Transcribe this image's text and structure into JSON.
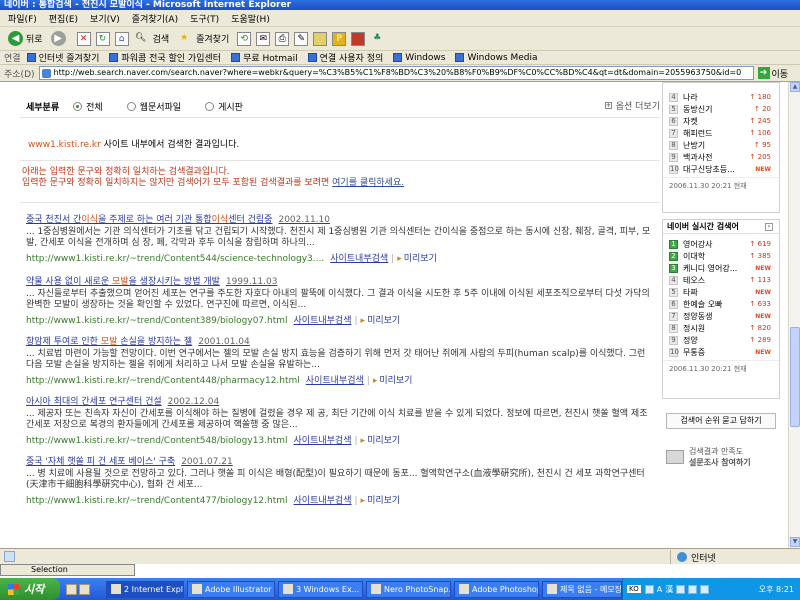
{
  "window": {
    "title": "네이버 : 통합검색 - 천진시 모발이식 - Microsoft Internet Explorer"
  },
  "menu": [
    "파일(F)",
    "편집(E)",
    "보기(V)",
    "즐겨찾기(A)",
    "도구(T)",
    "도움말(H)"
  ],
  "toolbar": {
    "back": "뒤로",
    "search": "검색",
    "favorites": "즐겨찾기"
  },
  "links": {
    "label": "연결",
    "items": [
      "인터넷 즐겨찾기",
      "파워콤 전국 할인 가입센터",
      "무료 Hotmail",
      "연결 사용자 정의",
      "Windows",
      "Windows Media"
    ]
  },
  "address": {
    "label": "주소(D)",
    "url": "http://web.search.naver.com/search.naver?where=webkr&query=%C3%B5%C1%F8%BD%C3%20%B8%F0%B9%DF%C0%CC%BD%C4&qt=dt&domain=2055963750&id=0",
    "go": "이동"
  },
  "filter": {
    "label": "세부분류",
    "options": [
      "전체",
      "웹문서파일",
      "게시판"
    ],
    "selected": "전체",
    "more": "옵션 더보기"
  },
  "intro": {
    "site": "www1.kisti.re.kr",
    "text": " 사이트 내부에서 검색한 결과입니다."
  },
  "notice": {
    "line1": "아래는 입력한 문구와 정확히 일치하는 검색결과입니다.",
    "line2": "입력한 문구와 정확히 일치하지는 않지만 검색어가 모두 포함된 검색결과를 보려면 ",
    "link": "여기를 클릭하세요."
  },
  "results": [
    {
      "title_pre": "중국 천진서 간",
      "title_hl": "이식",
      "title_mid": "을 주제로 하는 여러 기관 통합",
      "title_hl2": "이식",
      "title_post": "센터 건립중",
      "date": "2002.11.10",
      "desc": "... 1중심병원에서는 기관 의식센터가 기초를 닦고 건립되기 시작했다. 천진시 제 1중심병원 기관 의식센터는 간이식을 중점으로 하는 동시에 신장, 췌장, 골격, 피부, 모발, 간세포 이식을 전개하며 심 장, 폐, 각막과 후두 이식을 창립하며 하나의...",
      "url": "http://www1.kisti.re.kr/~trend/Content544/science-technology3....",
      "site_link": "사이트내부검색",
      "preview": "미리보기"
    },
    {
      "title_pre": "약물 사용 없이 새로운 ",
      "title_hl": "모발",
      "title_mid": "을 생장시키는 방법 개발",
      "title_hl2": "",
      "title_post": "",
      "date": "1999.11.03",
      "desc": "... 자신들로부터 추출했으며 얻어진 세포는 연구를 주도한 자호다 아내의 팔뚝에 이식했다. 그 결과 이식을 시도한 후 5주 이내에 이식된 세포조직으로부터 다섯 가닥의 완벽한 모발이 생장하는 것을 확인할 수 있었다. 연구진에 따르면, 이식된...",
      "url": "http://www1.kisti.re.kr/~trend/Content389/biology07.html",
      "site_link": "사이트내부검색",
      "preview": "미리보기"
    },
    {
      "title_pre": "항암제 투여로 인한 ",
      "title_hl": "모발",
      "title_mid": " 손실을 방지하는 젤",
      "title_hl2": "",
      "title_post": "",
      "date": "2001.01.04",
      "desc": "... 치료법 마련이 가능할 전망이다. 이번 연구에서는 젤의 모발 손실 방지 효능을 검증하기 위해 먼저 갓 태어난 쥐에게 사람의 두피(human scalp)를 이식했다. 그런 다음 모발 손실을 방지하는 젤을 쥐에게 처리하고 나서 모발 손실을 유발하는...",
      "url": "http://www1.kisti.re.kr/~trend/Content448/pharmacy12.html",
      "site_link": "사이트내부검색",
      "preview": "미리보기"
    },
    {
      "title_pre": "아시아 최대의 간세포 연구센터 건설",
      "title_hl": "",
      "title_mid": "",
      "title_hl2": "",
      "title_post": "",
      "date": "2002.12.04",
      "desc": "... 제공자 또는 친속자 자신이 간세포를 이식해야 하는 질병에 걸렸을 경우 제 공, 최단 기간에 이식 치료를 받을 수 있게 되었다. 정보에 따르면, 천진시 햇쏠 혈액 제조 간세포 저장으로 복경의 환자들에게 간세포를 제공하여 핵쏠행 중 많은...",
      "url": "http://www1.kisti.re.kr/~trend/Content548/biology13.html",
      "site_link": "사이트내부검색",
      "preview": "미리보기"
    },
    {
      "title_pre": "중국 '자체 햇쏠 피 건 세포 베이스' 구축",
      "title_hl": "",
      "title_mid": "",
      "title_hl2": "",
      "title_post": "",
      "date": "2001.07.21",
      "desc": "... 병 치료에 사용될 것으로 전망하고 있다. 그러나 햇쏠 피 이식은 배형(配型)이 필요하기 때문에 동포... 혈액학연구소(血液學硏究所), 천진시 건 세포 과학연구센터(天津市干細胞科學硏究中心), 협화 건 세포...",
      "url": "http://www1.kisti.re.kr/~trend/Content477/biology12.html",
      "site_link": "사이트내부검색",
      "preview": "미리보기"
    }
  ],
  "side": {
    "top_list": [
      {
        "n": "4",
        "w": "나라",
        "c": "180"
      },
      {
        "n": "5",
        "w": "동방신기",
        "c": "20"
      },
      {
        "n": "6",
        "w": "자켓",
        "c": "245"
      },
      {
        "n": "7",
        "w": "해피런드",
        "c": "106"
      },
      {
        "n": "8",
        "w": "난방기",
        "c": "95"
      },
      {
        "n": "9",
        "w": "백과사전",
        "c": "205"
      },
      {
        "n": "10",
        "w": "대구신당초등...",
        "c": "NEW"
      }
    ],
    "top_stamp": "2006.11.30 20:21 현재",
    "realtime_title": "네이버 실시간 검색어",
    "realtime": [
      {
        "n": "1",
        "w": "영어강사",
        "c": "619"
      },
      {
        "n": "2",
        "w": "이대학",
        "c": "385"
      },
      {
        "n": "3",
        "w": "케니디 영어강...",
        "c": "NEW"
      },
      {
        "n": "4",
        "w": "테오스",
        "c": "113"
      },
      {
        "n": "5",
        "w": "타짜",
        "c": "NEW"
      },
      {
        "n": "6",
        "w": "한예슬 오빠",
        "c": "633"
      },
      {
        "n": "7",
        "w": "정양동생",
        "c": "NEW"
      },
      {
        "n": "8",
        "w": "정시원",
        "c": "820"
      },
      {
        "n": "9",
        "w": "정양",
        "c": "289"
      },
      {
        "n": "10",
        "w": "무통증",
        "c": "NEW"
      }
    ],
    "realtime_stamp": "2006.11.30 20:21 현재",
    "ad_button": "검색어 순위 묻고 답하기",
    "survey_line1": "검색결과 만족도",
    "survey_line2": "설문조사 참여하기"
  },
  "status": {
    "zone": "인터넷"
  },
  "selection": {
    "label": "Selection"
  },
  "taskbar": {
    "start": "시작",
    "tasks": [
      "2 Internet Expl...",
      "Adobe Illustrator",
      "3 Windows Ex...",
      "Nero PhotoSnap...",
      "Adobe Photoshop",
      "제목 없음 - 메모장"
    ],
    "ime": "KO",
    "ime_a": "A",
    "ime_han": "漢",
    "clock": "오후 8:21"
  }
}
